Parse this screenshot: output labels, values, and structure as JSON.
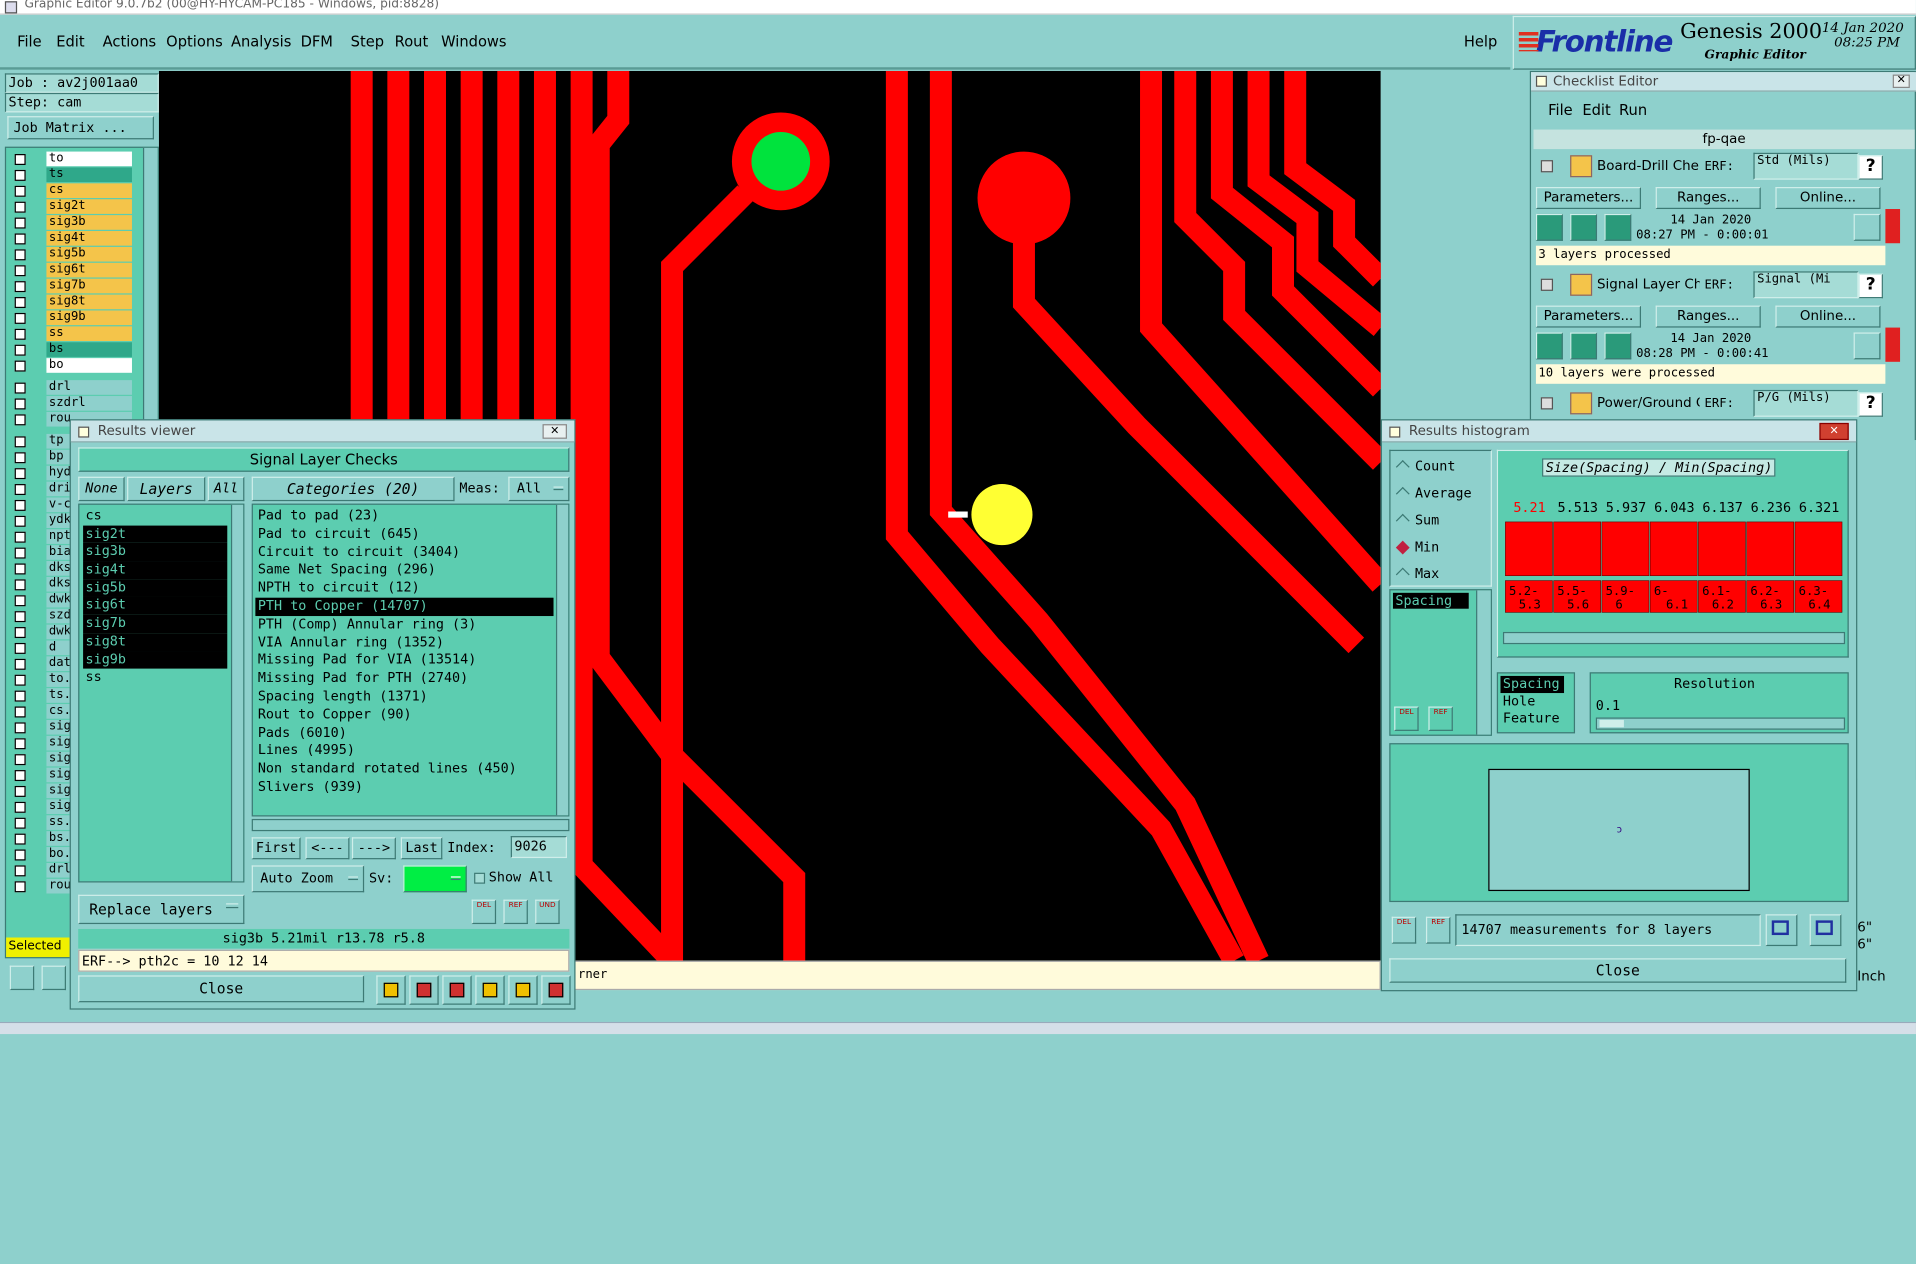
{
  "title_bar": "Graphic Editor 9.0.7b2 (00@HY-HYCAM-PC185 - Windows, pid:8828)",
  "menu": [
    "File",
    "Edit",
    "Actions",
    "Options",
    "Analysis",
    "DFM",
    "Step",
    "Rout",
    "Windows"
  ],
  "help": "Help",
  "brand": {
    "logo": "Frontline",
    "product": "Genesis 2000",
    "sub": "Graphic Editor",
    "date": "14 Jan 2020",
    "time": "08:25 PM"
  },
  "job": {
    "job": "Job : av2j001aa0",
    "step": "Step: cam",
    "matrix_button": "Job Matrix ..."
  },
  "layers_top": [
    "to",
    "ts",
    "cs",
    "sig2t",
    "sig3b",
    "sig4t",
    "sig5b",
    "sig6t",
    "sig7b",
    "sig8t",
    "sig9b",
    "ss",
    "bs",
    "bo"
  ],
  "layers_drill": [
    "drl",
    "szdrl",
    "rou"
  ],
  "layers_bottom": [
    "tp",
    "bp",
    "hyd",
    "dri",
    "v-c",
    "ydk",
    "npt",
    "bia",
    "dks",
    "dks",
    "dwk",
    "szd",
    "dwk",
    "d",
    "dat",
    "to.",
    "ts.",
    "cs.",
    "sig",
    "sig",
    "sig",
    "sig",
    "sig",
    "sig",
    "ss.",
    "bs.",
    "bo.",
    "drl",
    "rou"
  ],
  "selected_label": "Selected",
  "status_bottom": "rner",
  "checklist": {
    "title": "Checklist Editor",
    "menu": [
      "File",
      "Edit",
      "Run"
    ],
    "name": "fp-qae",
    "items": [
      {
        "name": "Board-Drill Che",
        "erf_label": "ERF:",
        "erf": "Std (Mils)",
        "params": "Parameters...",
        "ranges": "Ranges...",
        "online": "Online...",
        "date": "14 Jan 2020",
        "time": "08:27 PM - 0:00:01",
        "status": "3 layers processed"
      },
      {
        "name": "Signal Layer Ch",
        "erf_label": "ERF:",
        "erf": "Signal (Mi",
        "params": "Parameters...",
        "ranges": "Ranges...",
        "online": "Online...",
        "date": "14 Jan 2020",
        "time": "08:28 PM - 0:00:41",
        "status": "10 layers were processed"
      },
      {
        "name": "Power/Ground C",
        "erf_label": "ERF:",
        "erf": "P/G (Mils)"
      }
    ],
    "help": "?"
  },
  "results_viewer": {
    "title": "Results viewer",
    "header": "Signal Layer Checks",
    "none": "None",
    "layers": "Layers",
    "all": "All",
    "categories_label": "Categories (20)",
    "meas_label": "Meas:",
    "meas_value": "All",
    "layer_list": [
      "cs",
      "sig2t",
      "sig3b",
      "sig4t",
      "sig5b",
      "sig6t",
      "sig7b",
      "sig8t",
      "sig9b",
      "ss"
    ],
    "categories": [
      "Pad to pad (23)",
      "Pad to circuit (645)",
      "Circuit to circuit (3404)",
      "Same Net Spacing (296)",
      "NPTH to circuit (12)",
      "PTH to Copper (14707)",
      "PTH (Comp) Annular ring (3)",
      "VIA Annular ring (1352)",
      "Missing Pad for VIA (13514)",
      "Missing Pad for PTH (2740)",
      "Spacing length (1371)",
      "Rout to Copper (90)",
      "Pads (6010)",
      "Lines (4995)",
      "Non standard rotated lines (450)",
      "Slivers (939)"
    ],
    "first": "First",
    "prev": "<---",
    "next": "--->",
    "last": "Last",
    "index_label": "Index:",
    "index_value": "9026",
    "auto_zoom": "Auto Zoom",
    "sv_label": "Sv:",
    "show_all": "Show All",
    "replace_layers": "Replace layers",
    "status": "sig3b 5.21mil  r13.78  r5.8",
    "erf": "ERF--> pth2c = 10 12 14",
    "close": "Close"
  },
  "histogram": {
    "title": "Results histogram",
    "options": [
      "Count",
      "Average",
      "Sum",
      "Min",
      "Max"
    ],
    "selected_option": "Min",
    "list_item": "Spacing",
    "chart_title": "Size(Spacing) / Min(Spacing)",
    "resolution_label": "Resolution",
    "resolution_value": "0.1",
    "bins_list": [
      "Spacing",
      "Hole",
      "Feature"
    ],
    "summary": "14707 measurements for 8 layers",
    "close": "Close",
    "del": "DEL",
    "ref": "REF",
    "und": "UND",
    "right_edge": [
      "6\"",
      "6\"",
      "Inch"
    ]
  },
  "chart_data": {
    "type": "bar",
    "title": "Size(Spacing) / Min(Spacing)",
    "categories": [
      "5.2-5.3",
      "5.5-5.6",
      "5.9-6",
      "6-6.1",
      "6.1-6.2",
      "6.2-6.3",
      "6.3-6.4"
    ],
    "value_labels": [
      "5.21",
      "5.513",
      "5.937",
      "6.043",
      "6.137",
      "6.236",
      "6.321"
    ],
    "values": [
      5.21,
      5.513,
      5.937,
      6.043,
      6.137,
      6.236,
      6.321
    ],
    "highlight_color": "#ff0000"
  },
  "colors": {
    "teal": "#8ed0cc",
    "green": "#5ccdb0",
    "copper": "#ff0000",
    "board": "#000000"
  }
}
